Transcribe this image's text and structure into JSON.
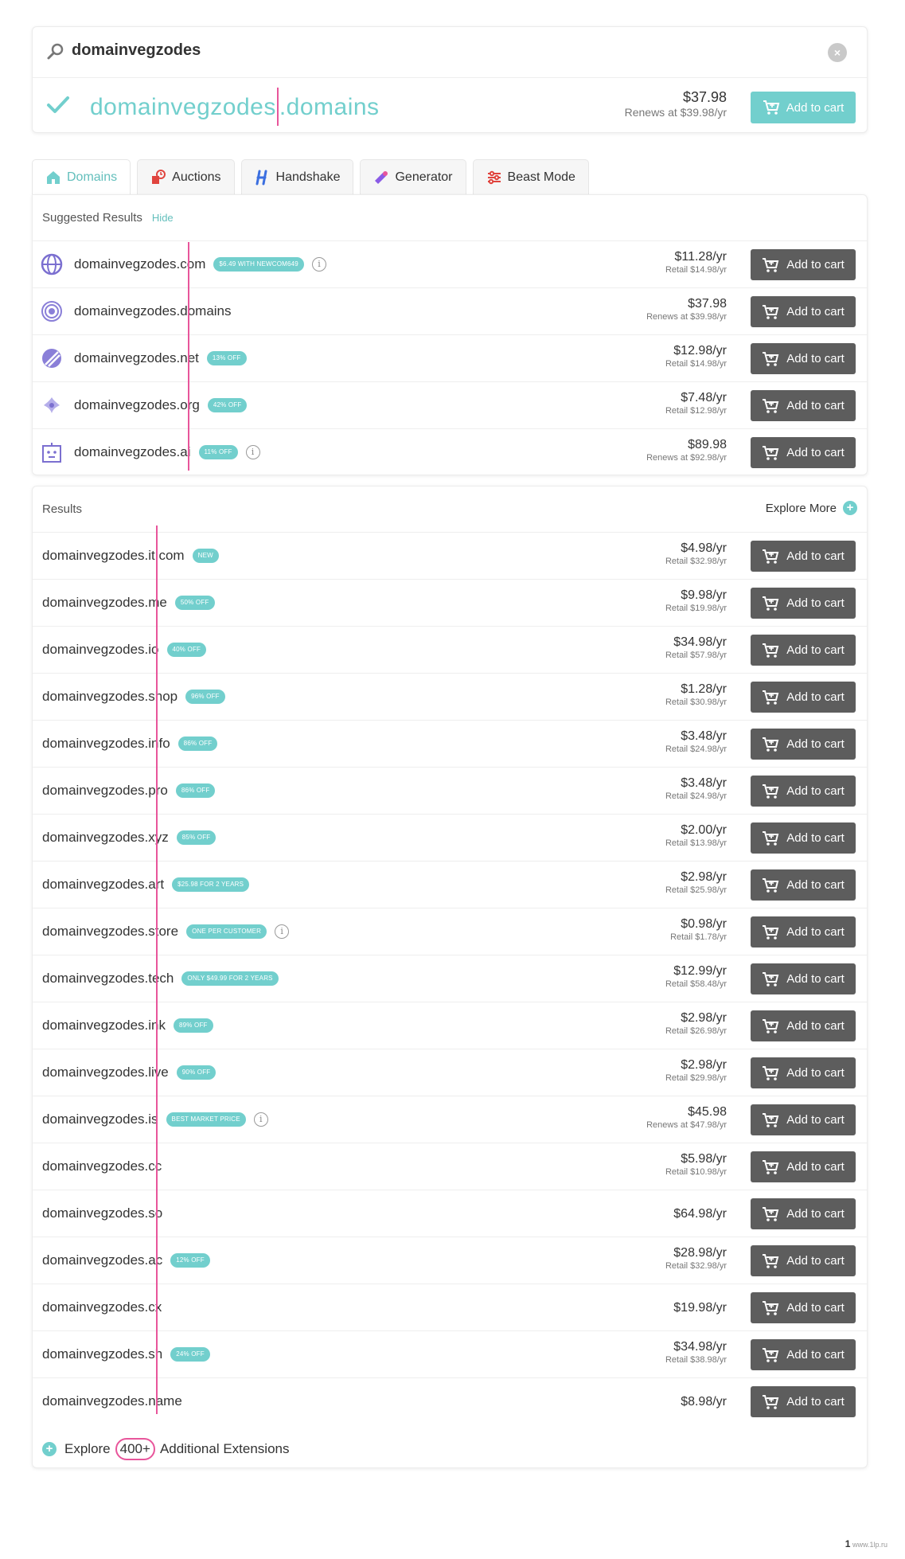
{
  "search": {
    "query": "domainvegzodes",
    "clear_label": "×"
  },
  "exact": {
    "sld": "domainvegzodes",
    "tld": ".domains",
    "price": "$37.98",
    "renews": "Renews at $39.98/yr",
    "cart_label": "Add to cart"
  },
  "tabs": [
    {
      "label": "Domains",
      "icon": "home-icon",
      "active": true
    },
    {
      "label": "Auctions",
      "icon": "auction-icon"
    },
    {
      "label": "Handshake",
      "icon": "handshake-icon"
    },
    {
      "label": "Generator",
      "icon": "generator-icon"
    },
    {
      "label": "Beast Mode",
      "icon": "sliders-icon"
    }
  ],
  "suggested": {
    "title": "Suggested Results",
    "hide_label": "Hide",
    "rows": [
      {
        "sld": "domainvegzodes",
        "tld": ".com",
        "badge": "$6.49 WITH NEWCOM649",
        "info": "i",
        "price": "$11.28/yr",
        "sub": "Retail $14.98/yr",
        "icon": "globe-icon"
      },
      {
        "sld": "domainvegzodes",
        "tld": ".domains",
        "badge": "",
        "price": "$37.98",
        "sub": "Renews at $39.98/yr",
        "icon": "target-icon"
      },
      {
        "sld": "domainvegzodes",
        "tld": ".net",
        "badge": "13% OFF",
        "price": "$12.98/yr",
        "sub": "Retail $14.98/yr",
        "icon": "net-icon"
      },
      {
        "sld": "domainvegzodes",
        "tld": ".org",
        "badge": "42% OFF",
        "price": "$7.48/yr",
        "sub": "Retail $12.98/yr",
        "icon": "org-icon"
      },
      {
        "sld": "domainvegzodes",
        "tld": ".ai",
        "badge": "11% OFF",
        "info": "i",
        "price": "$89.98",
        "sub": "Renews at $92.98/yr",
        "icon": "ai-robot-icon"
      }
    ]
  },
  "results": {
    "title": "Results",
    "explore_more": "Explore More",
    "plus": "+",
    "rows": [
      {
        "sld": "domainvegzodes",
        "tld": ".it.com",
        "badge": "NEW",
        "price": "$4.98/yr",
        "sub": "Retail $32.98/yr"
      },
      {
        "sld": "domainvegzodes",
        "tld": ".me",
        "badge": "50% OFF",
        "price": "$9.98/yr",
        "sub": "Retail $19.98/yr"
      },
      {
        "sld": "domainvegzodes",
        "tld": ".io",
        "badge": "40% OFF",
        "price": "$34.98/yr",
        "sub": "Retail $57.98/yr"
      },
      {
        "sld": "domainvegzodes",
        "tld": ".shop",
        "badge": "96% OFF",
        "price": "$1.28/yr",
        "sub": "Retail $30.98/yr"
      },
      {
        "sld": "domainvegzodes",
        "tld": ".info",
        "badge": "86% OFF",
        "price": "$3.48/yr",
        "sub": "Retail $24.98/yr"
      },
      {
        "sld": "domainvegzodes",
        "tld": ".pro",
        "badge": "86% OFF",
        "price": "$3.48/yr",
        "sub": "Retail $24.98/yr"
      },
      {
        "sld": "domainvegzodes",
        "tld": ".xyz",
        "badge": "85% OFF",
        "price": "$2.00/yr",
        "sub": "Retail $13.98/yr"
      },
      {
        "sld": "domainvegzodes",
        "tld": ".art",
        "badge": "$25.98 FOR 2 YEARS",
        "price": "$2.98/yr",
        "sub": "Retail $25.98/yr"
      },
      {
        "sld": "domainvegzodes",
        "tld": ".store",
        "badge": "ONE PER CUSTOMER",
        "info": "i",
        "price": "$0.98/yr",
        "sub": "Retail $1.78/yr"
      },
      {
        "sld": "domainvegzodes",
        "tld": ".tech",
        "badge": "ONLY $49.99 FOR 2 YEARS",
        "price": "$12.99/yr",
        "sub": "Retail $58.48/yr"
      },
      {
        "sld": "domainvegzodes",
        "tld": ".ink",
        "badge": "89% OFF",
        "price": "$2.98/yr",
        "sub": "Retail $26.98/yr"
      },
      {
        "sld": "domainvegzodes",
        "tld": ".live",
        "badge": "90% OFF",
        "price": "$2.98/yr",
        "sub": "Retail $29.98/yr"
      },
      {
        "sld": "domainvegzodes",
        "tld": ".is",
        "badge": "BEST MARKET PRICE",
        "info": "i",
        "price": "$45.98",
        "sub": "Renews at $47.98/yr"
      },
      {
        "sld": "domainvegzodes",
        "tld": ".cc",
        "badge": "",
        "price": "$5.98/yr",
        "sub": "Retail $10.98/yr"
      },
      {
        "sld": "domainvegzodes",
        "tld": ".so",
        "badge": "",
        "price": "$64.98/yr",
        "sub": ""
      },
      {
        "sld": "domainvegzodes",
        "tld": ".ac",
        "badge": "12% OFF",
        "price": "$28.98/yr",
        "sub": "Retail $32.98/yr"
      },
      {
        "sld": "domainvegzodes",
        "tld": ".cx",
        "badge": "",
        "price": "$19.98/yr",
        "sub": ""
      },
      {
        "sld": "domainvegzodes",
        "tld": ".sh",
        "badge": "24% OFF",
        "price": "$34.98/yr",
        "sub": "Retail $38.98/yr"
      },
      {
        "sld": "domainvegzodes",
        "tld": ".name",
        "badge": "",
        "price": "$8.98/yr",
        "sub": ""
      }
    ],
    "footer": {
      "prefix": "Explore",
      "count": "400+",
      "suffix": "Additional Extensions"
    }
  },
  "cart_label": "Add to cart",
  "watermark": {
    "num": "1",
    "text": "www.1lp.ru"
  },
  "colors": {
    "accent": "#72cfcd",
    "cart_button": "#5d5d5d",
    "annotation": "#e8559b"
  }
}
